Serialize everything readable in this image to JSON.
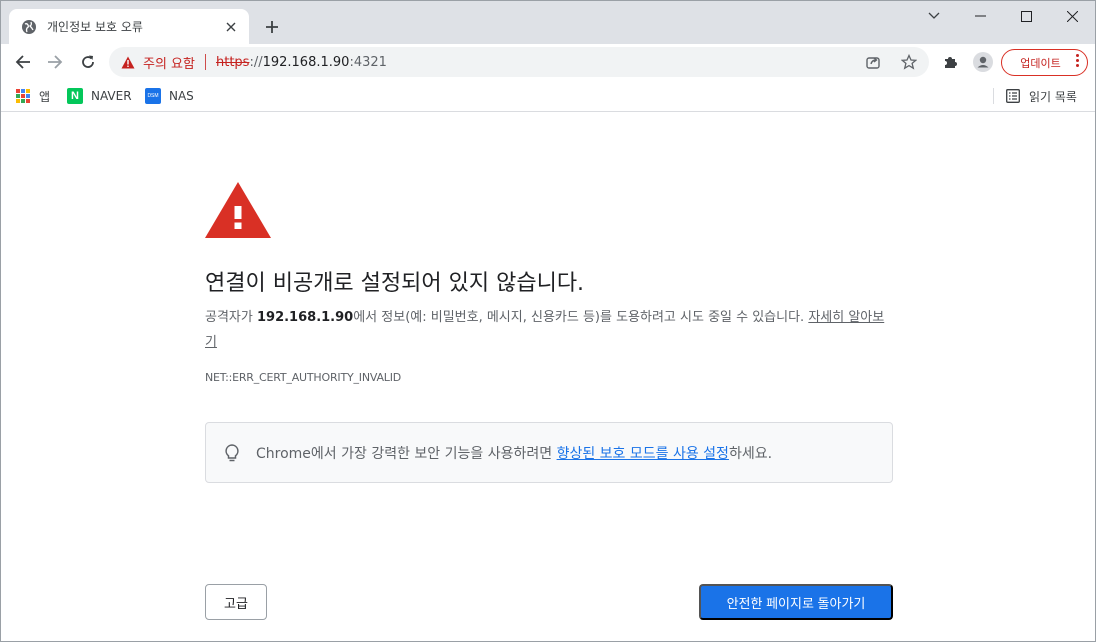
{
  "tab": {
    "title": "개인정보 보호 오류"
  },
  "omnibox": {
    "security_label": "주의 요함",
    "url_scheme": "https",
    "url_rest_prefix": "://",
    "url_host": "192.168.1.90",
    "url_port": ":4321"
  },
  "toolbar": {
    "update_label": "업데이트"
  },
  "bookmarks": {
    "items": [
      {
        "label": "앱",
        "icon": "apps-grid-icon"
      },
      {
        "label": "NAVER",
        "icon": "naver-icon",
        "icon_text": "N"
      },
      {
        "label": "NAS",
        "icon": "nas-icon",
        "icon_text": "DSM"
      }
    ],
    "reading_list": "읽기 목록"
  },
  "interstitial": {
    "heading": "연결이 비공개로 설정되어 있지 않습니다.",
    "explain_prefix": "공격자가 ",
    "explain_host": "192.168.1.90",
    "explain_suffix": "에서 정보(예: 비밀번호, 메시지, 신용카드 등)를 도용하려고 시도 중일 수 있습니다. ",
    "learn_more": "자세히 알아보기",
    "error_code": "NET::ERR_CERT_AUTHORITY_INVALID",
    "enhanced_prefix": "Chrome에서 가장 강력한 보안 기능을 사용하려면 ",
    "enhanced_link": "향상된 보호 모드를 사용 설정",
    "enhanced_suffix": "하세요.",
    "advanced_button": "고급",
    "back_button": "안전한 페이지로 돌아가기"
  },
  "colors": {
    "danger": "#d93025",
    "accent": "#1a73e8",
    "tabstrip": "#dee1e6",
    "omnibox_bg": "#f1f3f4"
  }
}
